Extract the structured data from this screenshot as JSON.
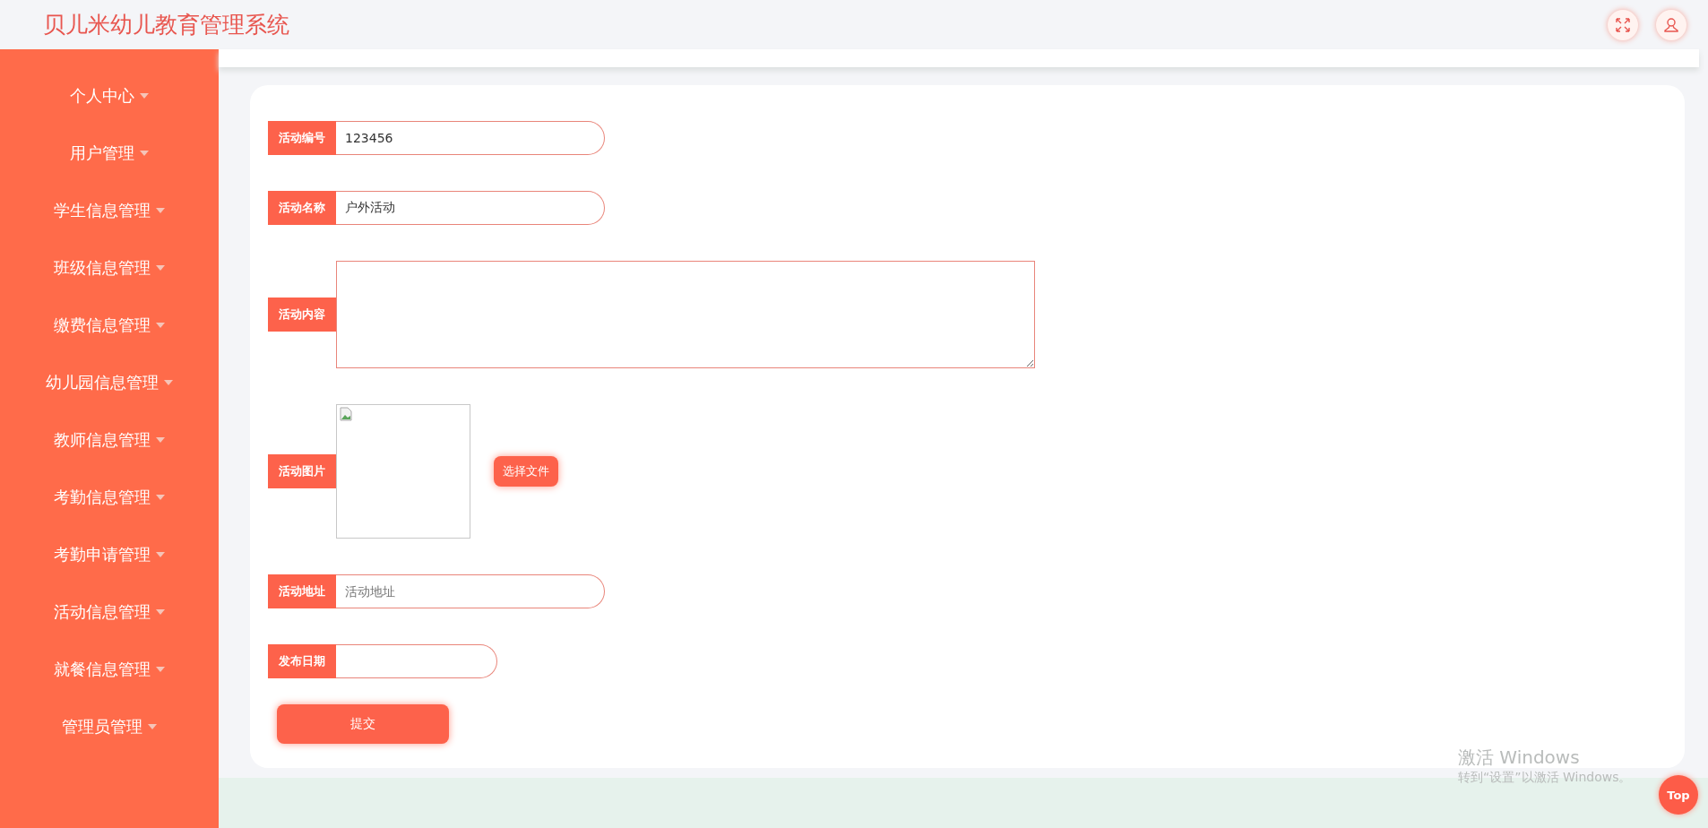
{
  "header": {
    "title": "贝儿米幼儿教育管理系统"
  },
  "sidebar": {
    "items": [
      {
        "label": "个人中心"
      },
      {
        "label": "用户管理"
      },
      {
        "label": "学生信息管理"
      },
      {
        "label": "班级信息管理"
      },
      {
        "label": "缴费信息管理"
      },
      {
        "label": "幼儿园信息管理"
      },
      {
        "label": "教师信息管理"
      },
      {
        "label": "考勤信息管理"
      },
      {
        "label": "考勤申请管理"
      },
      {
        "label": "活动信息管理"
      },
      {
        "label": "就餐信息管理"
      },
      {
        "label": "管理员管理"
      }
    ]
  },
  "form": {
    "fields": [
      {
        "kind": "text",
        "label": "活动编号",
        "value": "123456"
      },
      {
        "kind": "text",
        "label": "活动名称",
        "value": "户外活动"
      },
      {
        "kind": "textarea",
        "label": "活动内容"
      },
      {
        "kind": "image",
        "label": "活动图片",
        "button": "选择文件"
      },
      {
        "kind": "text",
        "label": "活动地址",
        "placeholder": "活动地址"
      },
      {
        "kind": "date",
        "label": "发布日期"
      }
    ],
    "submit": "提交"
  },
  "os_notice": {
    "title": "激活 Windows",
    "subtitle": "转到“设置”以激活 Windows。"
  },
  "back_to_top": "Top"
}
